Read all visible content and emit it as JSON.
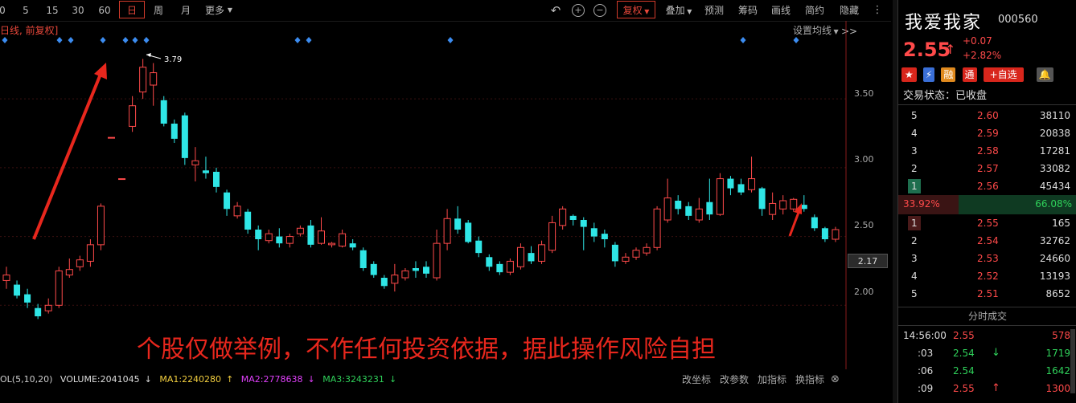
{
  "toolbar": {
    "periods": [
      "5",
      "15",
      "30",
      "60",
      "日",
      "周",
      "月",
      "更多"
    ],
    "active_period": "日",
    "actions": [
      "复权",
      "叠加",
      "预测",
      "筹码",
      "画线",
      "简约",
      "隐藏>>"
    ]
  },
  "chart_label": "日线, 前复权]",
  "setting_line": "设置均线",
  "high_marker": "3.79",
  "disclaimer": "个股仅做举例，不作任何投资依据，据此操作风险自担",
  "axis_ticks": [
    "3.50",
    "3.00",
    "2.50",
    "2.00"
  ],
  "current_price_tag": "2.17",
  "indicator": {
    "name": "OL(5,10,20)",
    "volume": "VOLUME:2041045",
    "ma1": "MA1:2240280",
    "ma2": "MA2:2778638",
    "ma3": "MA3:3243231",
    "buttons": [
      "改坐标",
      "改参数",
      "加指标",
      "换指标"
    ]
  },
  "stock": {
    "name": "我爱我家",
    "code": "000560",
    "price": "2.55",
    "change": "+0.07",
    "change_pct": "+2.82%",
    "status_label": "交易状态：",
    "status_value": "已收盘",
    "add_watch": "+自选",
    "badge_rong": "融",
    "badge_tong": "通"
  },
  "asks": [
    {
      "level": "5",
      "price": "2.60",
      "vol": "38110"
    },
    {
      "level": "4",
      "price": "2.59",
      "vol": "20838"
    },
    {
      "level": "3",
      "price": "2.58",
      "vol": "17281"
    },
    {
      "level": "2",
      "price": "2.57",
      "vol": "33082"
    },
    {
      "level": "1",
      "price": "2.56",
      "vol": "45434"
    }
  ],
  "ratio": {
    "left": "33.92%",
    "right": "66.08%"
  },
  "bids": [
    {
      "level": "1",
      "price": "2.55",
      "vol": "165"
    },
    {
      "level": "2",
      "price": "2.54",
      "vol": "32762"
    },
    {
      "level": "3",
      "price": "2.53",
      "vol": "24660"
    },
    {
      "level": "4",
      "price": "2.52",
      "vol": "13193"
    },
    {
      "level": "5",
      "price": "2.51",
      "vol": "8652"
    }
  ],
  "ticks_title": "分时成交",
  "ticks": [
    {
      "time": "14:56:00",
      "price": "2.55",
      "arrow": "",
      "vol": "578",
      "color": "#ff4a4a"
    },
    {
      "time": ":03",
      "price": "2.54",
      "arrow": "↓",
      "vol": "1719",
      "color": "#2fd15a"
    },
    {
      "time": ":06",
      "price": "2.54",
      "arrow": "",
      "vol": "1642",
      "color": "#2fd15a"
    },
    {
      "time": ":09",
      "price": "2.55",
      "arrow": "↑",
      "vol": "1300",
      "color": "#ff4a4a"
    }
  ],
  "chart_data": {
    "type": "candlestick",
    "ylim": [
      1.85,
      3.95
    ],
    "candles": [
      [
        2.18,
        2.22,
        2.12,
        2.28
      ],
      [
        2.15,
        2.07,
        2.05,
        2.18
      ],
      [
        2.08,
        2.02,
        1.98,
        2.12
      ],
      [
        1.98,
        1.92,
        1.9,
        2.01
      ],
      [
        1.96,
        2.0,
        1.94,
        2.05
      ],
      [
        2.0,
        2.25,
        1.98,
        2.28
      ],
      [
        2.22,
        2.26,
        2.2,
        2.34
      ],
      [
        2.28,
        2.33,
        2.25,
        2.36
      ],
      [
        2.32,
        2.44,
        2.28,
        2.48
      ],
      [
        2.44,
        2.72,
        2.4,
        2.74
      ],
      [
        3.22,
        3.22,
        3.22,
        3.22
      ],
      [
        2.92,
        2.92,
        2.92,
        2.92
      ],
      [
        3.3,
        3.45,
        3.26,
        3.52
      ],
      [
        3.55,
        3.73,
        3.5,
        3.79
      ],
      [
        3.6,
        3.69,
        3.45,
        3.76
      ],
      [
        3.49,
        3.32,
        3.3,
        3.52
      ],
      [
        3.32,
        3.21,
        3.18,
        3.35
      ],
      [
        3.38,
        3.07,
        3.02,
        3.4
      ],
      [
        3.02,
        3.05,
        2.9,
        3.15
      ],
      [
        2.98,
        2.96,
        2.92,
        3.08
      ],
      [
        2.97,
        2.86,
        2.82,
        3.0
      ],
      [
        2.82,
        2.7,
        2.65,
        2.84
      ],
      [
        2.65,
        2.72,
        2.63,
        2.75
      ],
      [
        2.68,
        2.55,
        2.52,
        2.7
      ],
      [
        2.55,
        2.48,
        2.4,
        2.58
      ],
      [
        2.47,
        2.52,
        2.45,
        2.55
      ],
      [
        2.5,
        2.45,
        2.42,
        2.56
      ],
      [
        2.45,
        2.5,
        2.42,
        2.52
      ],
      [
        2.52,
        2.56,
        2.5,
        2.58
      ],
      [
        2.58,
        2.44,
        2.42,
        2.62
      ],
      [
        2.45,
        2.54,
        2.44,
        2.64
      ],
      [
        2.44,
        2.45,
        2.42,
        2.46
      ],
      [
        2.43,
        2.52,
        2.42,
        2.55
      ],
      [
        2.45,
        2.42,
        2.4,
        2.48
      ],
      [
        2.4,
        2.27,
        2.25,
        2.42
      ],
      [
        2.3,
        2.22,
        2.2,
        2.32
      ],
      [
        2.2,
        2.14,
        2.12,
        2.22
      ],
      [
        2.16,
        2.22,
        2.1,
        2.3
      ],
      [
        2.2,
        2.25,
        2.18,
        2.27
      ],
      [
        2.27,
        2.25,
        2.2,
        2.32
      ],
      [
        2.28,
        2.23,
        2.2,
        2.32
      ],
      [
        2.2,
        2.45,
        2.18,
        2.55
      ],
      [
        2.45,
        2.63,
        2.4,
        2.7
      ],
      [
        2.63,
        2.55,
        2.52,
        2.72
      ],
      [
        2.6,
        2.46,
        2.45,
        2.62
      ],
      [
        2.47,
        2.38,
        2.35,
        2.5
      ],
      [
        2.35,
        2.28,
        2.25,
        2.37
      ],
      [
        2.3,
        2.24,
        2.22,
        2.32
      ],
      [
        2.24,
        2.32,
        2.22,
        2.34
      ],
      [
        2.28,
        2.42,
        2.26,
        2.45
      ],
      [
        2.38,
        2.32,
        2.3,
        2.43
      ],
      [
        2.32,
        2.44,
        2.3,
        2.47
      ],
      [
        2.4,
        2.6,
        2.38,
        2.65
      ],
      [
        2.58,
        2.7,
        2.55,
        2.72
      ],
      [
        2.65,
        2.62,
        2.58,
        2.66
      ],
      [
        2.62,
        2.57,
        2.4,
        2.64
      ],
      [
        2.56,
        2.5,
        2.46,
        2.6
      ],
      [
        2.52,
        2.48,
        2.42,
        2.55
      ],
      [
        2.44,
        2.32,
        2.28,
        2.46
      ],
      [
        2.32,
        2.35,
        2.3,
        2.38
      ],
      [
        2.35,
        2.4,
        2.33,
        2.42
      ],
      [
        2.38,
        2.42,
        2.36,
        2.45
      ],
      [
        2.42,
        2.7,
        2.4,
        2.72
      ],
      [
        2.62,
        2.78,
        2.6,
        2.92
      ],
      [
        2.76,
        2.7,
        2.66,
        2.8
      ],
      [
        2.72,
        2.65,
        2.62,
        2.75
      ],
      [
        2.62,
        2.7,
        2.6,
        2.78
      ],
      [
        2.75,
        2.66,
        2.62,
        2.92
      ],
      [
        2.66,
        2.92,
        2.65,
        2.96
      ],
      [
        2.92,
        2.85,
        2.8,
        2.94
      ],
      [
        2.88,
        2.82,
        2.8,
        2.92
      ],
      [
        2.84,
        2.92,
        2.82,
        3.08
      ],
      [
        2.85,
        2.7,
        2.65,
        2.86
      ],
      [
        2.66,
        2.74,
        2.62,
        2.82
      ],
      [
        2.7,
        2.76,
        2.66,
        2.8
      ],
      [
        2.7,
        2.77,
        2.68,
        2.78
      ],
      [
        2.73,
        2.7,
        2.68,
        2.8
      ],
      [
        2.64,
        2.56,
        2.54,
        2.66
      ],
      [
        2.56,
        2.48,
        2.46,
        2.57
      ],
      [
        2.48,
        2.55,
        2.46,
        2.57
      ]
    ]
  }
}
